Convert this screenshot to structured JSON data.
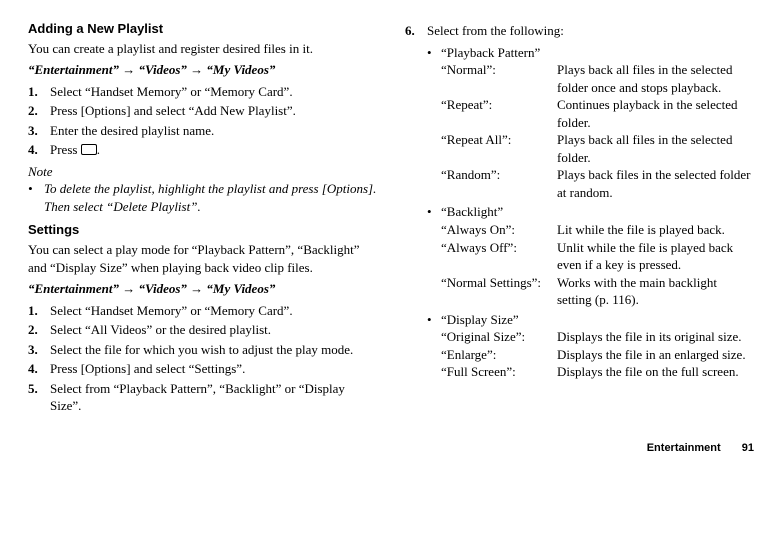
{
  "left": {
    "h1": "Adding a New Playlist",
    "p1": "You can create a playlist and register desired files in it.",
    "path1": "“Entertainment” → “Videos” → “My Videos”",
    "steps1": [
      {
        "n": "1.",
        "t": "Select “Handset Memory” or “Memory Card”."
      },
      {
        "n": "2.",
        "t": "Press [Options] and select “Add New Playlist”."
      },
      {
        "n": "3.",
        "t": "Enter the desired playlist name."
      },
      {
        "n": "4.",
        "t": "Press ",
        "t2": "."
      }
    ],
    "noteH": "Note",
    "notes": [
      "To delete the playlist, highlight the playlist and press [Options]. Then select “Delete Playlist”."
    ],
    "h2": "Settings",
    "p2": "You can select a play mode for “Playback Pattern”, “Backlight” and “Display Size” when playing back video clip files.",
    "path2": "“Entertainment” → “Videos” → “My Videos”",
    "steps2": [
      {
        "n": "1.",
        "t": "Select “Handset Memory” or “Memory Card”."
      },
      {
        "n": "2.",
        "t": "Select “All Videos” or the desired playlist."
      },
      {
        "n": "3.",
        "t": "Select the file for which you wish to adjust the play mode."
      },
      {
        "n": "4.",
        "t": "Press [Options] and select “Settings”."
      },
      {
        "n": "5.",
        "t": "Select from “Playback Pattern”, “Backlight” or “Display Size”."
      }
    ]
  },
  "right": {
    "step6": {
      "n": "6.",
      "t": "Select from the following:"
    },
    "groups": [
      {
        "title": "“Playback Pattern”",
        "rows": [
          {
            "l": "“Normal”:",
            "d": "Plays back all files in the selected folder once and stops playback."
          },
          {
            "l": "“Repeat”:",
            "d": "Continues playback in the selected folder."
          },
          {
            "l": "“Repeat All”:",
            "d": "Plays back all files in the selected folder."
          },
          {
            "l": "“Random”:",
            "d": "Plays back files in the selected folder at random."
          }
        ]
      },
      {
        "title": "“Backlight”",
        "rows": [
          {
            "l": "“Always On”:",
            "d": "Lit while the file is played back."
          },
          {
            "l": "“Always Off”:",
            "d": "Unlit while the file is played back even if a key is pressed."
          },
          {
            "l": "“Normal Settings”:",
            "d": "Works with the main backlight setting (p. 116)."
          }
        ]
      },
      {
        "title": "“Display Size”",
        "rows": [
          {
            "l": "“Original Size”:",
            "d": "Displays the file in its original size."
          },
          {
            "l": "“Enlarge”:",
            "d": "Displays the file in an enlarged size."
          },
          {
            "l": "“Full Screen”:",
            "d": "Displays the file on the full screen."
          }
        ]
      }
    ]
  },
  "footer": {
    "section": "Entertainment",
    "page": "91"
  }
}
